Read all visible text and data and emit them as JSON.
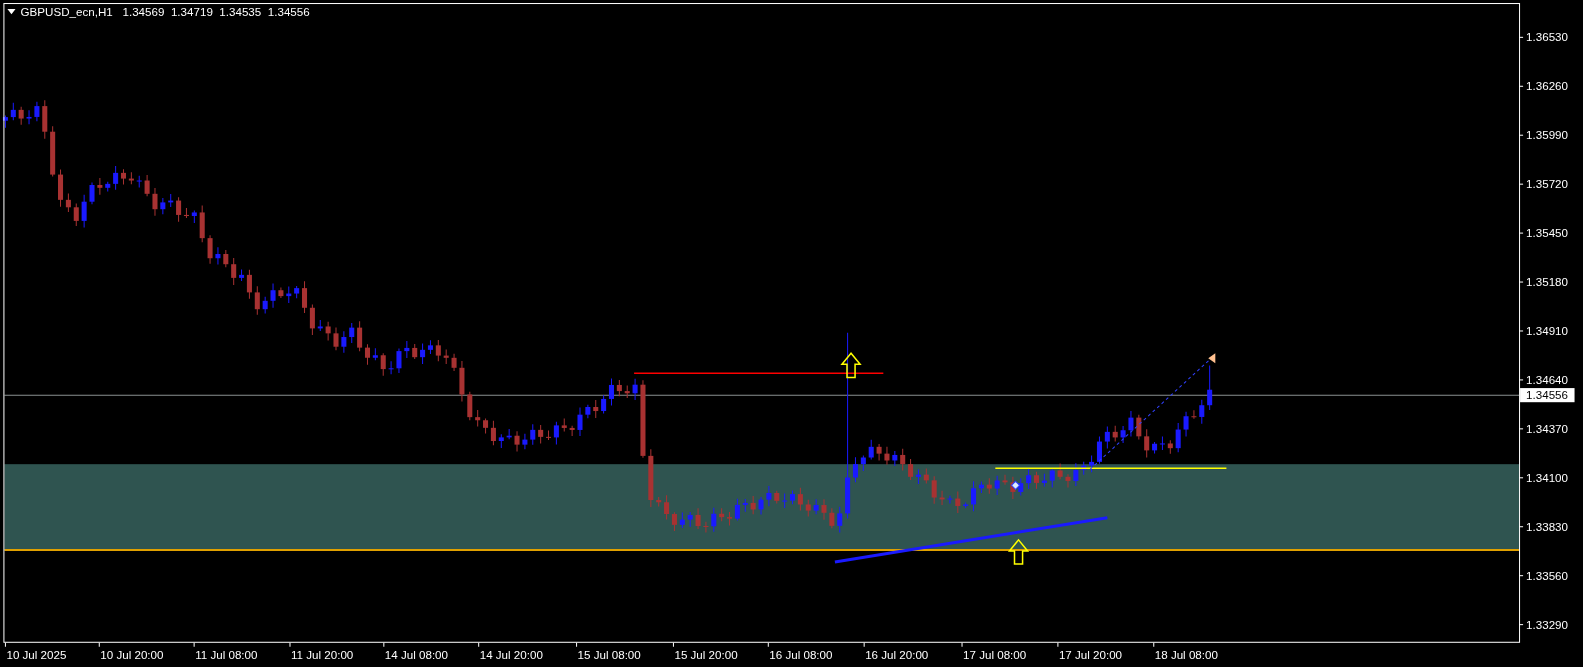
{
  "header": {
    "symbol": "GBPUSD_ecn,H1",
    "ohlc": [
      "1.34569",
      "1.34719",
      "1.34535",
      "1.34556"
    ]
  },
  "price_axis": {
    "labels": [
      "1.36530",
      "1.36260",
      "1.35990",
      "1.35720",
      "1.35450",
      "1.35180",
      "1.34910",
      "1.34640",
      "1.34370",
      "1.34100",
      "1.33830",
      "1.33560",
      "1.33290"
    ],
    "current_price": "1.34556"
  },
  "time_axis": {
    "labels": [
      "10 Jul 2025",
      "10 Jul 20:00",
      "11 Jul 08:00",
      "11 Jul 20:00",
      "14 Jul 08:00",
      "14 Jul 20:00",
      "15 Jul 08:00",
      "15 Jul 20:00",
      "16 Jul 08:00",
      "16 Jul 20:00",
      "17 Jul 08:00",
      "17 Jul 20:00",
      "18 Jul 08:00"
    ]
  }
}
